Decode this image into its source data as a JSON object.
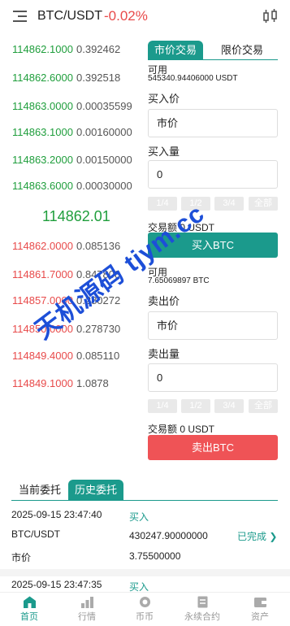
{
  "header": {
    "pair": "BTC/USDT",
    "change": "-0.02%"
  },
  "orderbook": {
    "asks": [
      {
        "price": "114862.1000",
        "qty": "0.392462"
      },
      {
        "price": "114862.6000",
        "qty": "0.392518"
      },
      {
        "price": "114863.0000",
        "qty": "0.00035599"
      },
      {
        "price": "114863.1000",
        "qty": "0.00160000"
      },
      {
        "price": "114863.2000",
        "qty": "0.00150000"
      },
      {
        "price": "114863.6000",
        "qty": "0.00030000"
      }
    ],
    "last_price": "114862.01",
    "bids": [
      {
        "price": "114862.0000",
        "qty": "0.085136"
      },
      {
        "price": "114861.7000",
        "qty": "0.847808"
      },
      {
        "price": "114857.0000",
        "qty": "0.280272"
      },
      {
        "price": "114850.0000",
        "qty": "0.278730"
      },
      {
        "price": "114849.4000",
        "qty": "0.085110"
      },
      {
        "price": "114849.1000",
        "qty": "1.0878"
      }
    ]
  },
  "trade": {
    "tabs": [
      "市价交易",
      "限价交易"
    ],
    "buy": {
      "available_label": "可用",
      "available_value": "545340.94406000 USDT",
      "price_label": "买入价",
      "price_value": "市价",
      "qty_label": "买入量",
      "qty_value": "0",
      "percents": [
        "1/4",
        "1/2",
        "3/4",
        "全部"
      ],
      "amount": "交易额 0 USDT",
      "button": "买入BTC"
    },
    "sell": {
      "available_label": "可用",
      "available_value": "7.65069897 BTC",
      "price_label": "卖出价",
      "price_value": "市价",
      "qty_label": "卖出量",
      "qty_value": "0",
      "percents": [
        "1/4",
        "1/2",
        "3/4",
        "全部"
      ],
      "amount": "交易额 0 USDT",
      "button": "卖出BTC"
    }
  },
  "watermark": "天机源码 tjym.cc",
  "orders": {
    "tabs": [
      "当前委托",
      "历史委托"
    ],
    "items": [
      {
        "time": "2025-09-15 23:47:40",
        "side": "买入",
        "pair": "BTC/USDT",
        "amount": "430247.90000000",
        "status": "已完成",
        "type": "市价",
        "price": "3.75500000"
      },
      {
        "time": "2025-09-15 23:47:35",
        "side": "买入"
      }
    ]
  },
  "nav": {
    "items": [
      "首页",
      "行情",
      "币币",
      "永续合约",
      "资产"
    ]
  },
  "colors": {
    "accent": "#1b9a8c",
    "up": "#1f9e3c",
    "down": "#e84a4a",
    "sell_button": "#ef5356"
  }
}
